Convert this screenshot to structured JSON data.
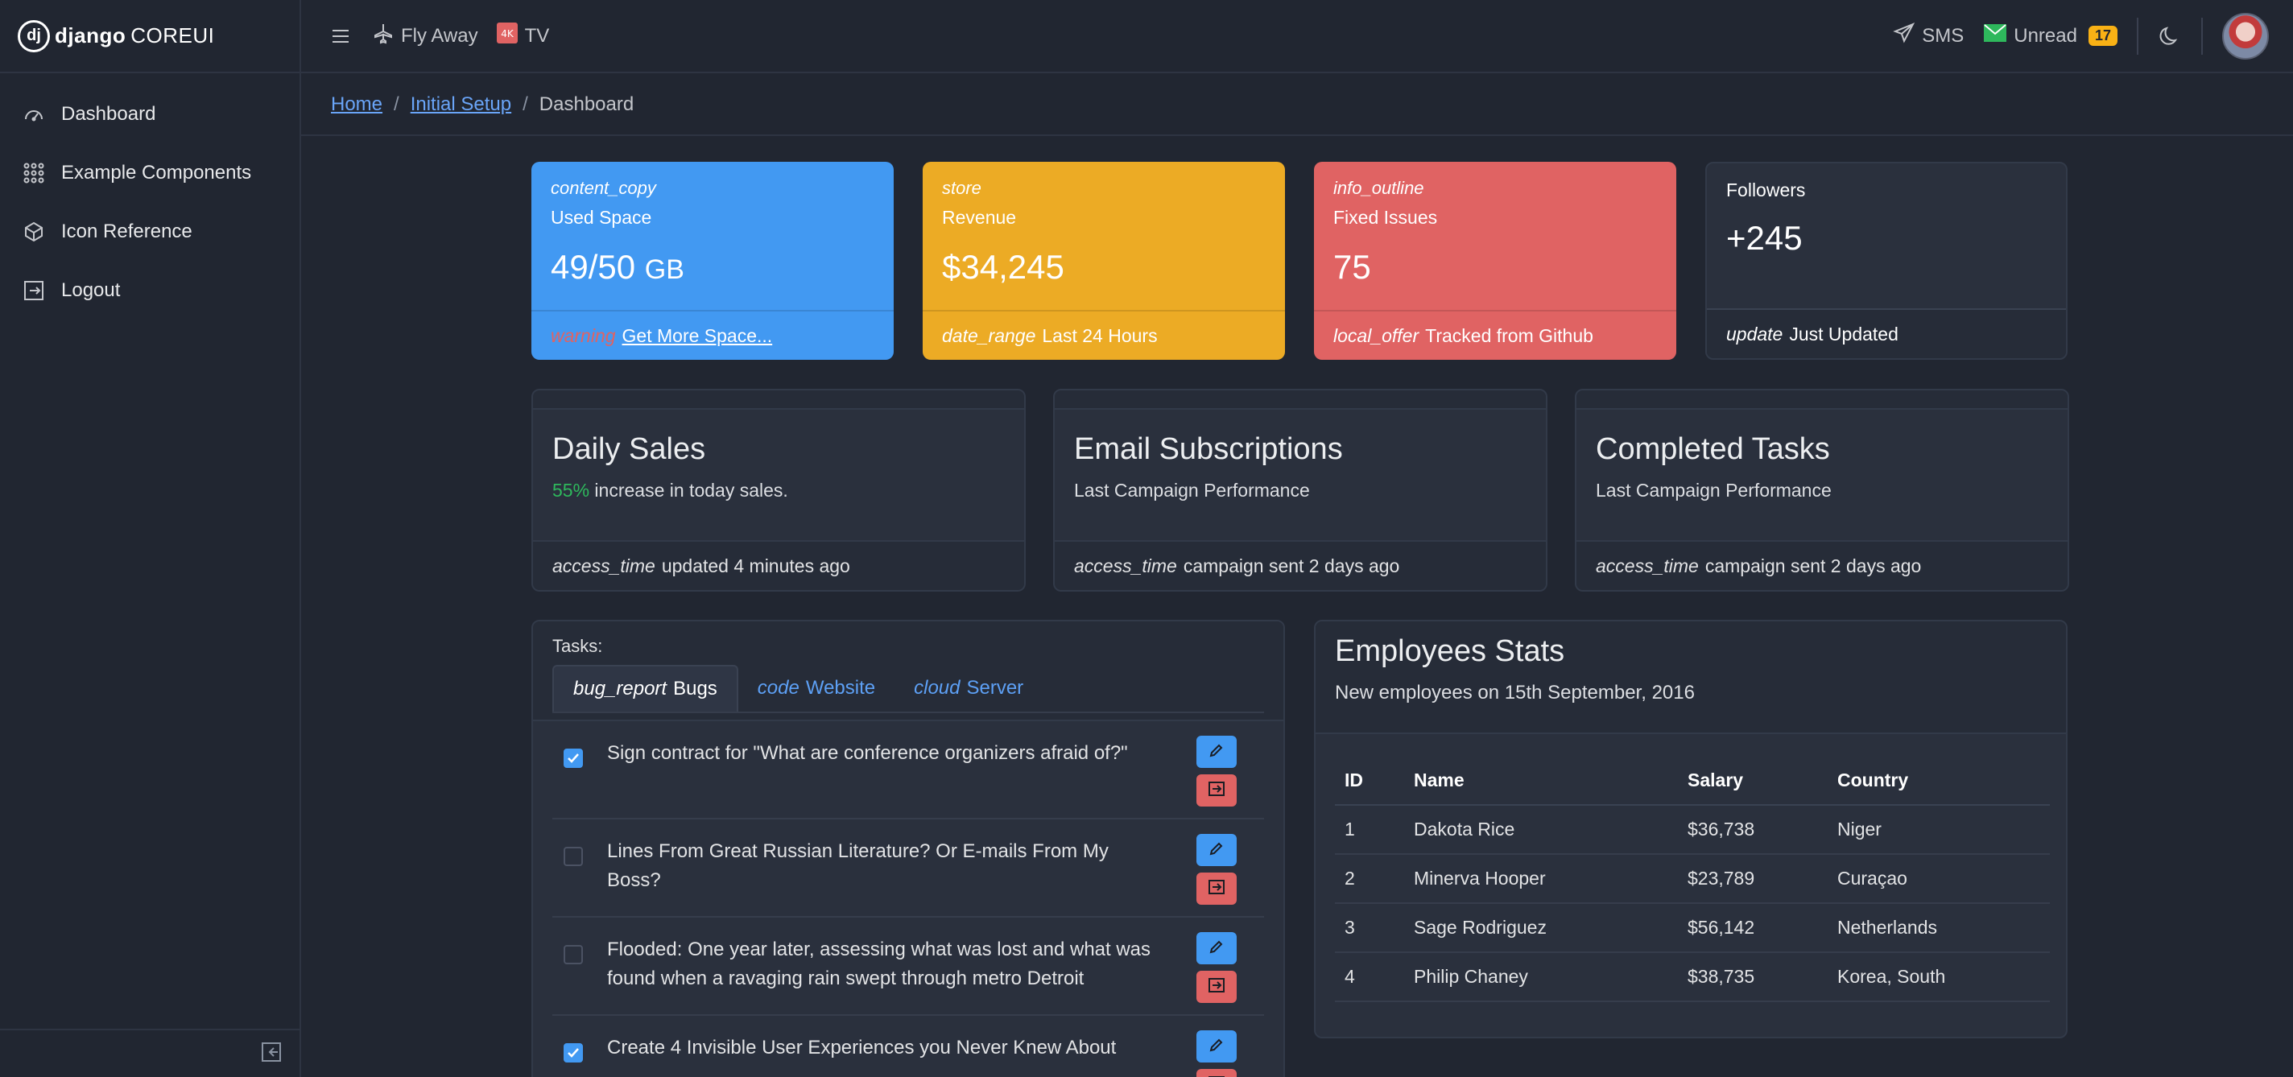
{
  "brand": {
    "name": "django",
    "suffix": "COREUI",
    "mark": "dj"
  },
  "sidebar": {
    "items": [
      {
        "label": "Dashboard",
        "icon": "speedometer-icon"
      },
      {
        "label": "Example Components",
        "icon": "grid-dots-icon"
      },
      {
        "label": "Icon Reference",
        "icon": "cube-icon"
      },
      {
        "label": "Logout",
        "icon": "logout-icon"
      }
    ]
  },
  "header": {
    "links": [
      {
        "label": "Fly Away",
        "icon": "airplane-icon"
      },
      {
        "label": "TV",
        "icon": "4k-tv-icon"
      }
    ],
    "sms_label": "SMS",
    "unread_label": "Unread",
    "unread_count": "17"
  },
  "breadcrumb": {
    "home": "Home",
    "setup": "Initial Setup",
    "current": "Dashboard",
    "sep": "/"
  },
  "stats": [
    {
      "kicker": "content_copy",
      "label": "Used Space",
      "value": "49/50",
      "unit": "GB",
      "foot_icon": "warning",
      "foot_text": "Get More Space...",
      "color": "#4299f2"
    },
    {
      "kicker": "store",
      "label": "Revenue",
      "value": "$34,245",
      "foot_icon": "date_range",
      "foot_text": "Last 24 Hours",
      "color": "#ecab25"
    },
    {
      "kicker": "info_outline",
      "label": "Fixed Issues",
      "value": "75",
      "foot_icon": "local_offer",
      "foot_text": "Tracked from Github",
      "color": "#e06363"
    },
    {
      "label": "Followers",
      "value": "+245",
      "foot_icon": "update",
      "foot_text": "Just Updated"
    }
  ],
  "cards": [
    {
      "title": "Daily Sales",
      "highlight": "55%",
      "sub": " increase in today sales.",
      "foot_icon": "access_time",
      "foot_text": "updated 4 minutes ago"
    },
    {
      "title": "Email Subscriptions",
      "sub": "Last Campaign Performance",
      "foot_icon": "access_time",
      "foot_text": "campaign sent 2 days ago"
    },
    {
      "title": "Completed Tasks",
      "sub": "Last Campaign Performance",
      "foot_icon": "access_time",
      "foot_text": "campaign sent 2 days ago"
    }
  ],
  "tasks": {
    "label": "Tasks:",
    "tabs": [
      {
        "icon": "bug_report",
        "label": "Bugs"
      },
      {
        "icon": "code",
        "label": "Website"
      },
      {
        "icon": "cloud",
        "label": "Server"
      }
    ],
    "items": [
      {
        "text": "Sign contract for \"What are conference organizers afraid of?\"",
        "checked": true
      },
      {
        "text": "Lines From Great Russian Literature? Or E-mails From My Boss?",
        "checked": false
      },
      {
        "text": "Flooded: One year later, assessing what was lost and what was found when a ravaging rain swept through metro Detroit",
        "checked": false
      },
      {
        "text": "Create 4 Invisible User Experiences you Never Knew About",
        "checked": true
      }
    ]
  },
  "employees": {
    "title": "Employees Stats",
    "sub": "New employees on 15th September, 2016",
    "columns": [
      "ID",
      "Name",
      "Salary",
      "Country"
    ],
    "rows": [
      [
        "1",
        "Dakota Rice",
        "$36,738",
        "Niger"
      ],
      [
        "2",
        "Minerva Hooper",
        "$23,789",
        "Curaçao"
      ],
      [
        "3",
        "Sage Rodriguez",
        "$56,142",
        "Netherlands"
      ],
      [
        "4",
        "Philip Chaney",
        "$38,735",
        "Korea, South"
      ]
    ]
  },
  "colors": {
    "accent": "#4299f2",
    "warning": "#ecab25",
    "danger": "#e06363",
    "success": "#2eb85c",
    "link": "#6aa5f8"
  }
}
